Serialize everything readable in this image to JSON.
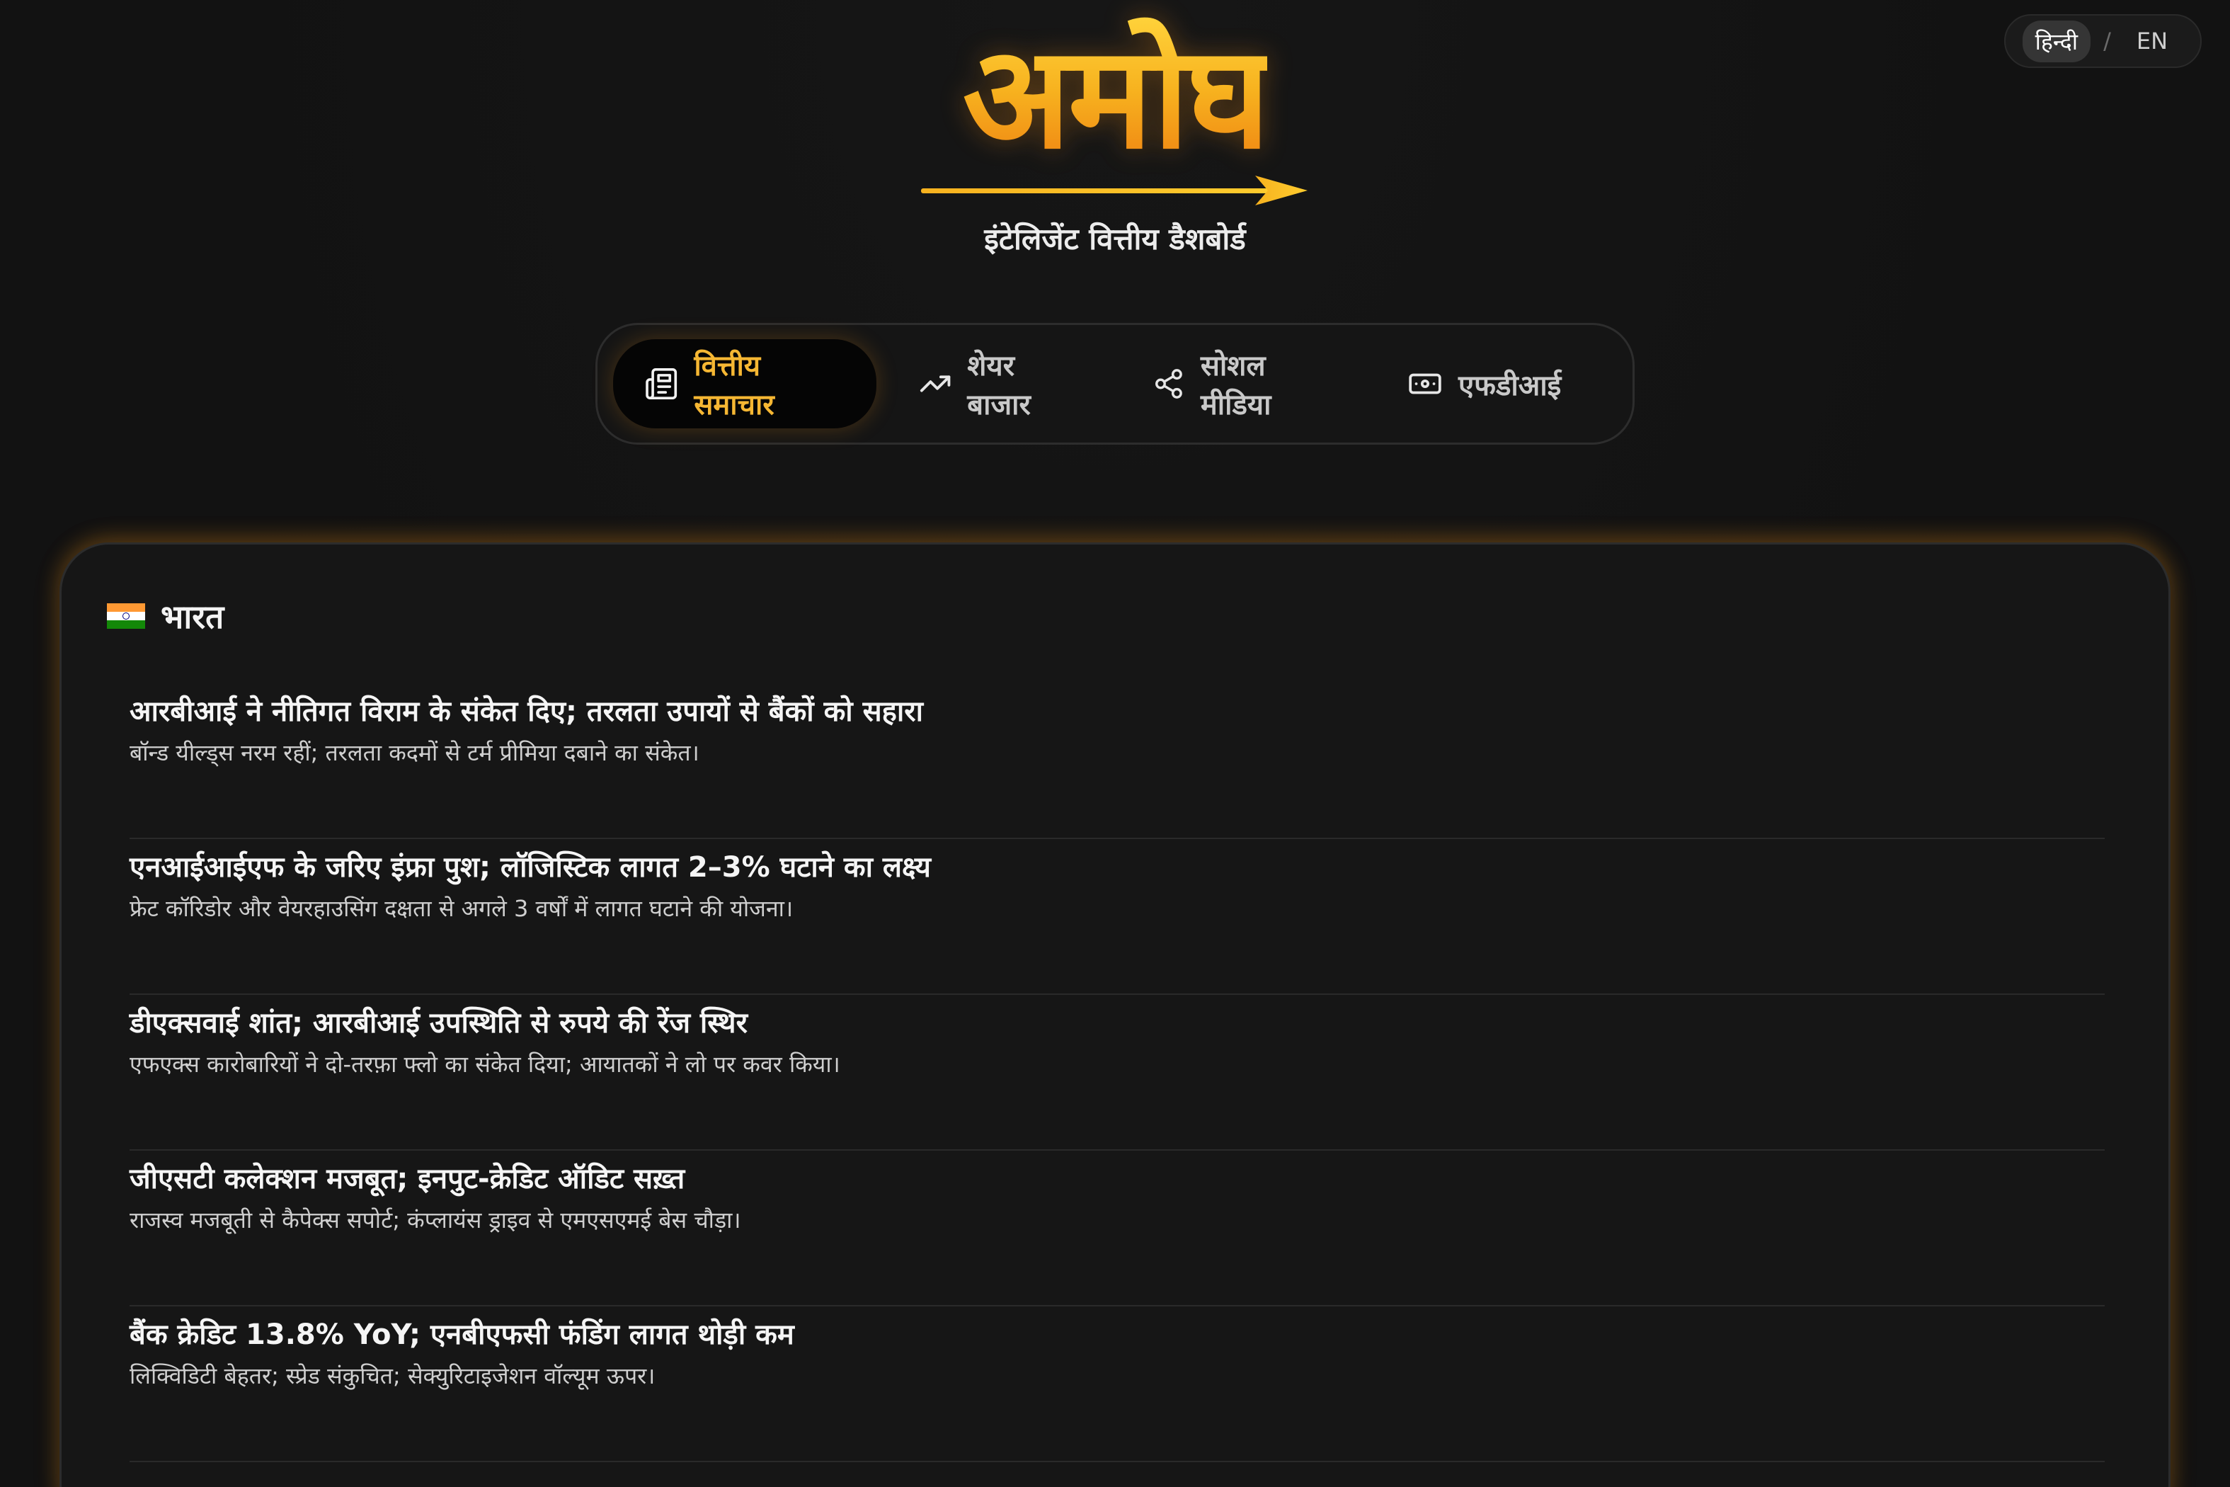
{
  "language": {
    "options": [
      "हिन्दी",
      "EN"
    ],
    "active": "हिन्दी",
    "separator": "/"
  },
  "brand": {
    "logo_text": "अमोघ",
    "subtitle": "इंटेलिजेंट वित्तीय डैशबोर्ड"
  },
  "tabs": [
    {
      "label": "वित्तीय समाचार",
      "icon": "newspaper-icon",
      "active": true
    },
    {
      "label": "शेयर बाजार",
      "icon": "trending-up-icon",
      "active": false
    },
    {
      "label": "सोशल मीडिया",
      "icon": "share-icon",
      "active": false
    },
    {
      "label": "एफडीआई",
      "icon": "banknote-icon",
      "active": false
    }
  ],
  "section": {
    "title": "भारत",
    "flag": "india-flag-icon"
  },
  "news": [
    {
      "title": "आरबीआई ने नीतिगत विराम के संकेत दिए; तरलता उपायों से बैंकों को सहारा",
      "desc": "बॉन्ड यील्ड्स नरम रहीं; तरलता कदमों से टर्म प्रीमिया दबाने का संकेत।"
    },
    {
      "title": "एनआईआईएफ के जरिए इंफ्रा पुश; लॉजिस्टिक लागत 2–3% घटाने का लक्ष्य",
      "desc": "फ्रेट कॉरिडोर और वेयरहाउसिंग दक्षता से अगले 3 वर्षों में लागत घटाने की योजना।"
    },
    {
      "title": "डीएक्सवाई शांत; आरबीआई उपस्थिति से रुपये की रेंज स्थिर",
      "desc": "एफएक्स कारोबारियों ने दो-तरफ़ा फ्लो का संकेत दिया; आयातकों ने लो पर कवर किया।"
    },
    {
      "title": "जीएसटी कलेक्शन मजबूत; इनपुट-क्रेडिट ऑडिट सख़्त",
      "desc": "राजस्व मजबूती से कैपेक्स सपोर्ट; कंप्लायंस ड्राइव से एमएसएमई बेस चौड़ा।"
    },
    {
      "title": "बैंक क्रेडिट 13.8% YoY; एनबीएफसी फंडिंग लागत थोड़ी कम",
      "desc": "लिक्विडिटी बेहतर; स्प्रेड संकुचित; सेक्युरिटाइजेशन वॉल्यूम ऊपर।"
    }
  ],
  "colors": {
    "background": "#121212",
    "accent": "#f6b733",
    "logo_gradient_top": "#ffd23a",
    "logo_gradient_bottom": "#ee7d10",
    "card": "#161616"
  }
}
